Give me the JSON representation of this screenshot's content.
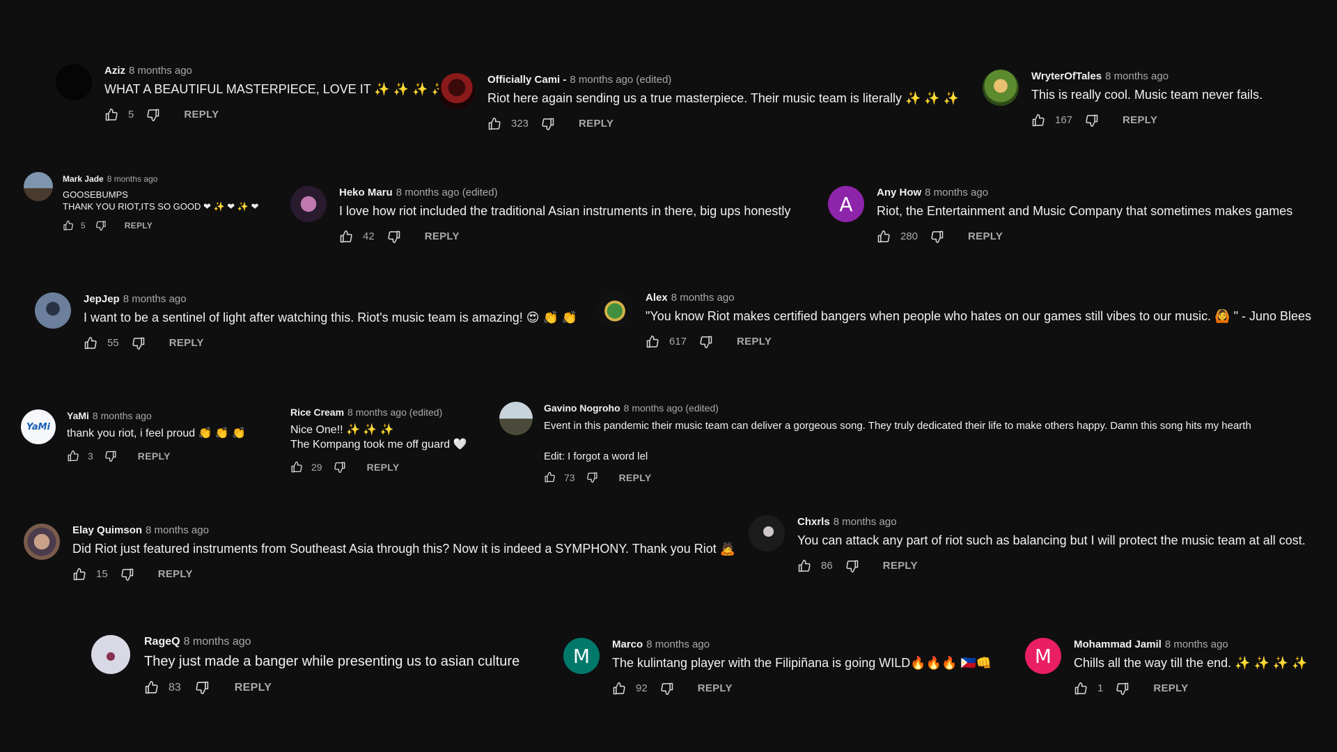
{
  "ui": {
    "reply_label": "REPLY",
    "like_icon": "thumbs-up-icon",
    "dislike_icon": "thumbs-down-icon"
  },
  "comments": [
    {
      "author": "Aziz",
      "time": "8 months ago",
      "text": [
        "WHAT A BEAUTIFUL MASTERPIECE, LOVE IT ✨ ✨ ✨ ✨"
      ],
      "likes": "5",
      "avatar_letter": "",
      "avatar_color": "#050505"
    },
    {
      "author": "Officially Cami -",
      "time": "8 months ago (edited)",
      "text": [
        "Riot here again sending us a true masterpiece. Their music team is literally ✨ ✨ ✨"
      ],
      "likes": "323",
      "avatar_letter": "",
      "avatar_color": "#8b1a1a"
    },
    {
      "author": "WryterOfTales",
      "time": "8 months ago",
      "text": [
        "This is really cool. Music team never fails."
      ],
      "likes": "167",
      "avatar_letter": "",
      "avatar_color": "#5c8a2e"
    },
    {
      "author": "Mark Jade",
      "time": "8 months ago",
      "text": [
        "GOOSEBUMPS",
        "THANK YOU RIOT,ITS SO GOOD ❤ ✨ ❤ ✨ ❤"
      ],
      "likes": "5",
      "avatar_letter": "",
      "avatar_color": "#6e7f92"
    },
    {
      "author": "Heko Maru",
      "time": "8 months ago (edited)",
      "text": [
        "I love how riot included the traditional Asian instruments in there, big ups honestly"
      ],
      "likes": "42",
      "avatar_letter": "",
      "avatar_color": "#2a1a2e"
    },
    {
      "author": "Any How",
      "time": "8 months ago",
      "text": [
        "Riot, the Entertainment and Music Company that sometimes makes games"
      ],
      "likes": "280",
      "avatar_letter": "A",
      "avatar_color": "#8e24aa"
    },
    {
      "author": "JepJep",
      "time": "8 months ago",
      "text": [
        "I want to be a sentinel of light after watching this. Riot's music team is amazing! 😍 👏 👏"
      ],
      "likes": "55",
      "avatar_letter": "",
      "avatar_color": "#4a5a75"
    },
    {
      "author": "Alex",
      "time": "8 months ago",
      "text": [
        "\"You know Riot makes certified bangers when people who hates on our games still vibes to our music. 🙆 \" - Juno Blees"
      ],
      "likes": "617",
      "avatar_letter": "",
      "avatar_color": "#111111"
    },
    {
      "author": "YaMi",
      "time": "8 months ago",
      "text": [
        "thank you riot, i feel proud 👏 👏 👏"
      ],
      "likes": "3",
      "avatar_letter": "YaMi",
      "avatar_color": "#f5f7fb"
    },
    {
      "author": "Rice Cream",
      "time": "8 months ago (edited)",
      "text": [
        "Nice One!! ✨ ✨ ✨",
        "The Kompang took me off guard 🤍"
      ],
      "likes": "29",
      "avatar_letter": "",
      "avatar_color": ""
    },
    {
      "author": "Gavino Nogroho",
      "time": "8 months ago (edited)",
      "text": [
        "Event in this pandemic their music team can deliver a gorgeous song. They truly dedicated their life to make others happy. Damn this song hits my hearth",
        "Edit: I forgot a word lel"
      ],
      "likes": "73",
      "avatar_letter": "",
      "avatar_color": "#c8d4dc"
    },
    {
      "author": "Elay Quimson",
      "time": "8 months ago",
      "text": [
        "Did Riot just featured instruments from Southeast Asia through this? Now it is indeed a SYMPHONY. Thank you Riot 🙇"
      ],
      "likes": "15",
      "avatar_letter": "",
      "avatar_color": "#7a5c4c"
    },
    {
      "author": "Chxrls",
      "time": "8 months ago",
      "text": [
        "You can attack any part of riot such as balancing but I will protect the music team at all cost."
      ],
      "likes": "86",
      "avatar_letter": "",
      "avatar_color": "#1c1c1c"
    },
    {
      "author": "RageQ",
      "time": "8 months ago",
      "text": [
        "They just made a banger while presenting us to asian culture"
      ],
      "likes": "83",
      "avatar_letter": "",
      "avatar_color": "#d9d9e6"
    },
    {
      "author": "Marco",
      "time": "8 months ago",
      "text": [
        "The kulintang player with the Filipiñana is going WILD🔥🔥🔥 🇵🇭👊"
      ],
      "likes": "92",
      "avatar_letter": "M",
      "avatar_color": "#00796b"
    },
    {
      "author": "Mohammad Jamil",
      "time": "8 months ago",
      "text": [
        "Chills all the way till the end. ✨ ✨ ✨ ✨"
      ],
      "likes": "1",
      "avatar_letter": "M",
      "avatar_color": "#e91e63"
    }
  ]
}
